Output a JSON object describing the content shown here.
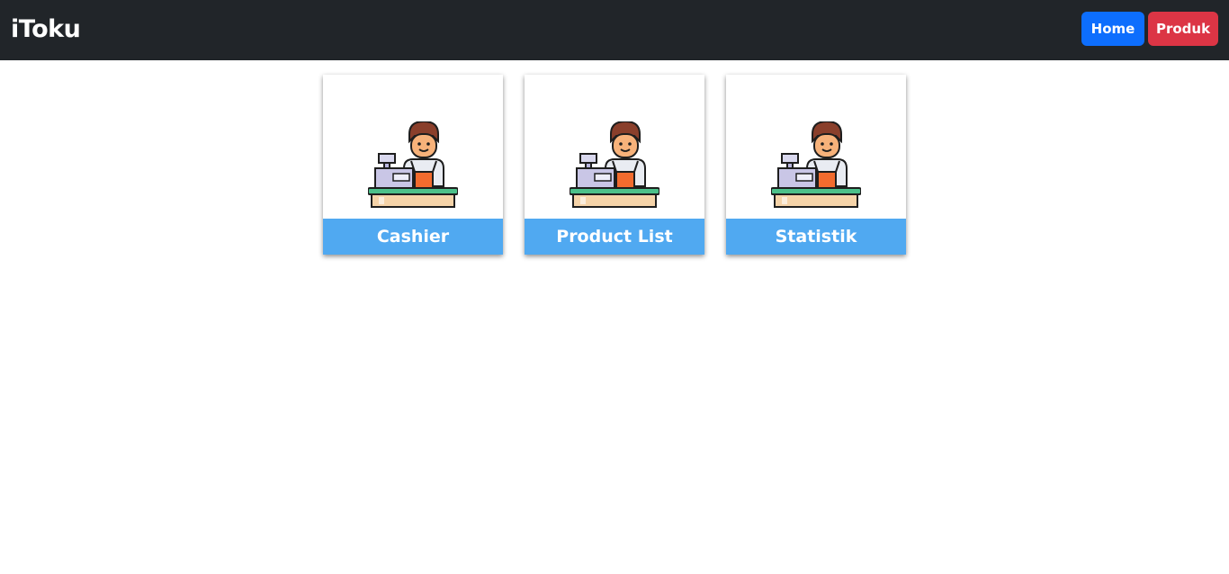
{
  "header": {
    "brand": "iToku",
    "buttons": {
      "home": "Home",
      "produk": "Produk"
    }
  },
  "colors": {
    "navbar": "#212529",
    "home_button": "#0d6efd",
    "produk_button": "#dc3545",
    "card_label_bg": "#50a9f1"
  },
  "menu": {
    "cards": [
      {
        "label": "Cashier",
        "icon": "cashier-icon"
      },
      {
        "label": "Product List",
        "icon": "cashier-icon"
      },
      {
        "label": "Statistik",
        "icon": "cashier-icon"
      }
    ]
  }
}
